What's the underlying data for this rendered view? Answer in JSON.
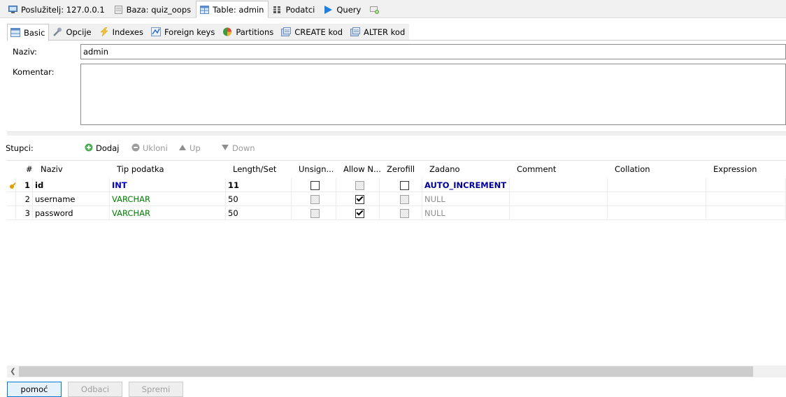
{
  "top_tabs": [
    {
      "label": "Poslužitelj: 127.0.0.1",
      "icon": "server-icon"
    },
    {
      "label": "Baza: quiz_oops",
      "icon": "database-icon"
    },
    {
      "label": "Table: admin",
      "icon": "table-icon"
    },
    {
      "label": "Podatci",
      "icon": "data-grid-icon"
    },
    {
      "label": "Query",
      "icon": "play-icon"
    },
    {
      "label": "",
      "icon": "new-query-icon"
    }
  ],
  "sub_tabs": [
    {
      "label": "Basic",
      "icon": "table-icon"
    },
    {
      "label": "Opcije",
      "icon": "wrench-icon"
    },
    {
      "label": "Indexes",
      "icon": "lightning-icon"
    },
    {
      "label": "Foreign keys",
      "icon": "foreign-key-icon"
    },
    {
      "label": "Partitions",
      "icon": "pie-icon"
    },
    {
      "label": "CREATE kod",
      "icon": "code-icon"
    },
    {
      "label": "ALTER kod",
      "icon": "code-icon"
    }
  ],
  "form": {
    "name_label": "Naziv:",
    "name_value": "admin",
    "comment_label": "Komentar:",
    "comment_value": ""
  },
  "columns_toolbar": {
    "label": "Stupci:",
    "add": "Dodaj",
    "remove": "Ukloni",
    "up": "Up",
    "down": "Down"
  },
  "grid": {
    "headers": [
      "#",
      "Naziv",
      "Tip podatka",
      "Length/Set",
      "Unsign...",
      "Allow N...",
      "Zerofill",
      "Zadano",
      "Comment",
      "Collation",
      "Expression"
    ],
    "rows": [
      {
        "num": "1",
        "name": "id",
        "type": "INT",
        "length": "11",
        "unsigned": false,
        "allow_null": false,
        "zerofill": false,
        "default": "AUTO_INCREMENT",
        "comment": "",
        "collation": "",
        "expression": "",
        "primary_key": true
      },
      {
        "num": "2",
        "name": "username",
        "type": "VARCHAR",
        "length": "50",
        "unsigned": false,
        "allow_null": true,
        "zerofill": false,
        "default": "NULL",
        "comment": "",
        "collation": "",
        "expression": "",
        "primary_key": false
      },
      {
        "num": "3",
        "name": "password",
        "type": "VARCHAR",
        "length": "50",
        "unsigned": false,
        "allow_null": true,
        "zerofill": false,
        "default": "NULL",
        "comment": "",
        "collation": "",
        "expression": "",
        "primary_key": false
      }
    ]
  },
  "buttons": {
    "help": "pomoć",
    "discard": "Odbaci",
    "save": "Spremi"
  },
  "colors": {
    "int_type": "#0000cc",
    "varchar_type": "#008000",
    "auto_increment": "#000099",
    "null_default": "#8d8d8d",
    "key_icon": "#e0a000"
  }
}
